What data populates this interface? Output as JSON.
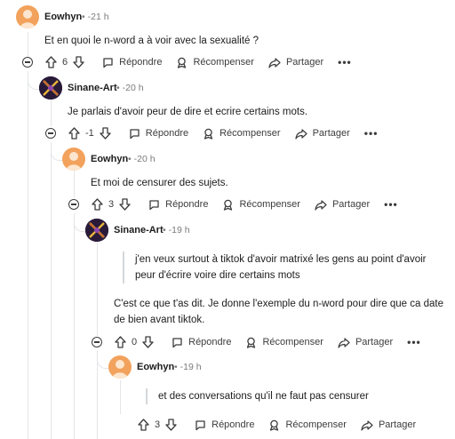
{
  "comments": [
    {
      "author": "Eowhyn",
      "time": "-21 h",
      "text": "Et en quoi le n-word a à voir avec la sexualité ?",
      "votes": "6",
      "reply": "Répondre",
      "award": "Récompenser",
      "share": "Partager",
      "more": "•••"
    },
    {
      "author": "Sinane-Art",
      "time": "-20 h",
      "text": "Je parlais d'avoir peur de dire et ecrire certains mots.",
      "votes": "-1",
      "reply": "Répondre",
      "award": "Récompenser",
      "share": "Partager",
      "more": "•••"
    },
    {
      "author": "Eowhyn",
      "time": "-20 h",
      "text": "Et moi de censurer des sujets.",
      "votes": "3",
      "reply": "Répondre",
      "award": "Récompenser",
      "share": "Partager",
      "more": "•••"
    },
    {
      "author": "Sinane-Art",
      "time": "-19 h",
      "quote_lines": [
        "j'en veux surtout à tiktok d'avoir matrixé les gens au point d'avoir",
        "peur d'écrire voire dire certains mots"
      ],
      "text_lines": [
        "C'est ce que t'as dit. Je donne l'exemple du n-word pour dire que ca date",
        "de bien avant tiktok."
      ],
      "votes": "0",
      "reply": "Répondre",
      "award": "Récompenser",
      "share": "Partager",
      "more": "•••"
    },
    {
      "author": "Eowhyn",
      "time": "-19 h",
      "quote_lines": [
        "et des conversations qu'il ne faut pas censurer"
      ],
      "votes": "3",
      "reply": "Répondre",
      "award": "Récompenser",
      "share": "Partager",
      "more": "•••"
    }
  ],
  "separator": "•",
  "colors": {
    "thread_line": "#e3e5e8",
    "avatar_eowhyn": "#f2a25c",
    "avatar_sinane": "#2a1a3a",
    "text": "#1c1c1c",
    "meta": "#7c7c7c"
  },
  "icons": [
    "upvote-icon",
    "downvote-icon",
    "comment-icon",
    "award-icon",
    "share-icon",
    "collapse-icon",
    "more-icon"
  ]
}
